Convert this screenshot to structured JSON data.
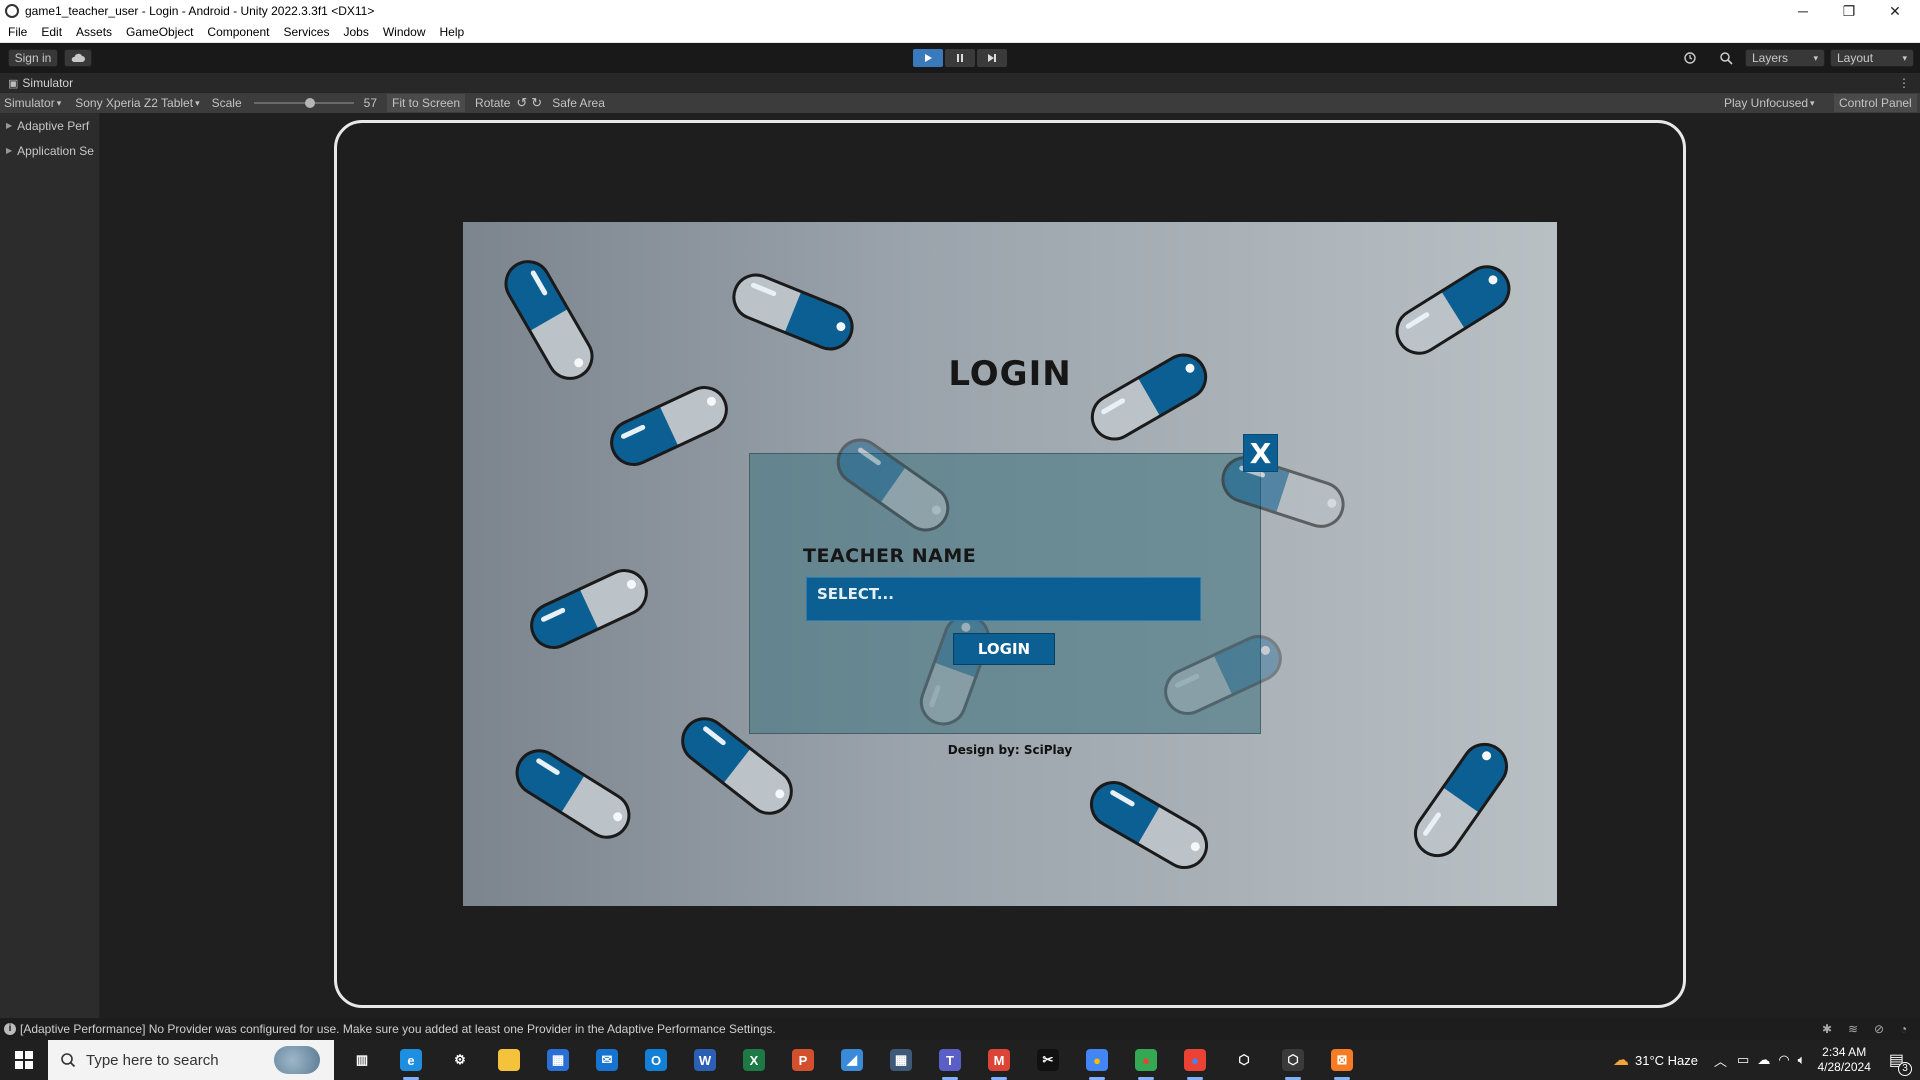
{
  "window": {
    "title": "game1_teacher_user - Login - Android - Unity 2022.3.3f1 <DX11>",
    "minimize": "─",
    "restore": "❐",
    "close": "✕"
  },
  "menu": [
    "File",
    "Edit",
    "Assets",
    "GameObject",
    "Component",
    "Services",
    "Jobs",
    "Window",
    "Help"
  ],
  "toolbar": {
    "sign_in": "Sign in",
    "layers": "Layers",
    "layout": "Layout"
  },
  "simulator": {
    "tab_label": "Simulator",
    "mode": "Simulator",
    "device": "Sony Xperia Z2 Tablet",
    "scale_label": "Scale",
    "scale_value": "57",
    "scale_fraction": 0.57,
    "fit_to_screen": "Fit to Screen",
    "rotate": "Rotate",
    "safe_area": "Safe Area",
    "play_mode": "Play Unfocused",
    "control_panel": "Control Panel",
    "folds": [
      "Adaptive Perf",
      "Application Se"
    ]
  },
  "game": {
    "title": "LOGIN",
    "close_label": "X",
    "teacher_label": "TEACHER NAME",
    "select_placeholder": "SELECT...",
    "login_button": "LOGIN",
    "credit": "Design by: SciPlay",
    "pill_blue": "#0c5f92",
    "pill_gray": "#bcc3c8"
  },
  "status": {
    "message": "[Adaptive Performance] No Provider was configured for use. Make sure you added at least one Provider in the Adaptive Performance Settings."
  },
  "taskbar": {
    "search_placeholder": "Type here to search",
    "weather": "31°C  Haze",
    "time": "2:34 AM",
    "date": "4/28/2024",
    "notifications": "3",
    "apps": [
      "task-view",
      "edge",
      "settings",
      "file-explorer",
      "store",
      "mail",
      "outlook",
      "word",
      "excel",
      "powerpoint",
      "app-blue",
      "calculator",
      "teams",
      "chrome-m",
      "capcut",
      "chrome-1",
      "chrome-2",
      "chrome-3",
      "unity-hub",
      "unity-editor",
      "xampp"
    ]
  }
}
